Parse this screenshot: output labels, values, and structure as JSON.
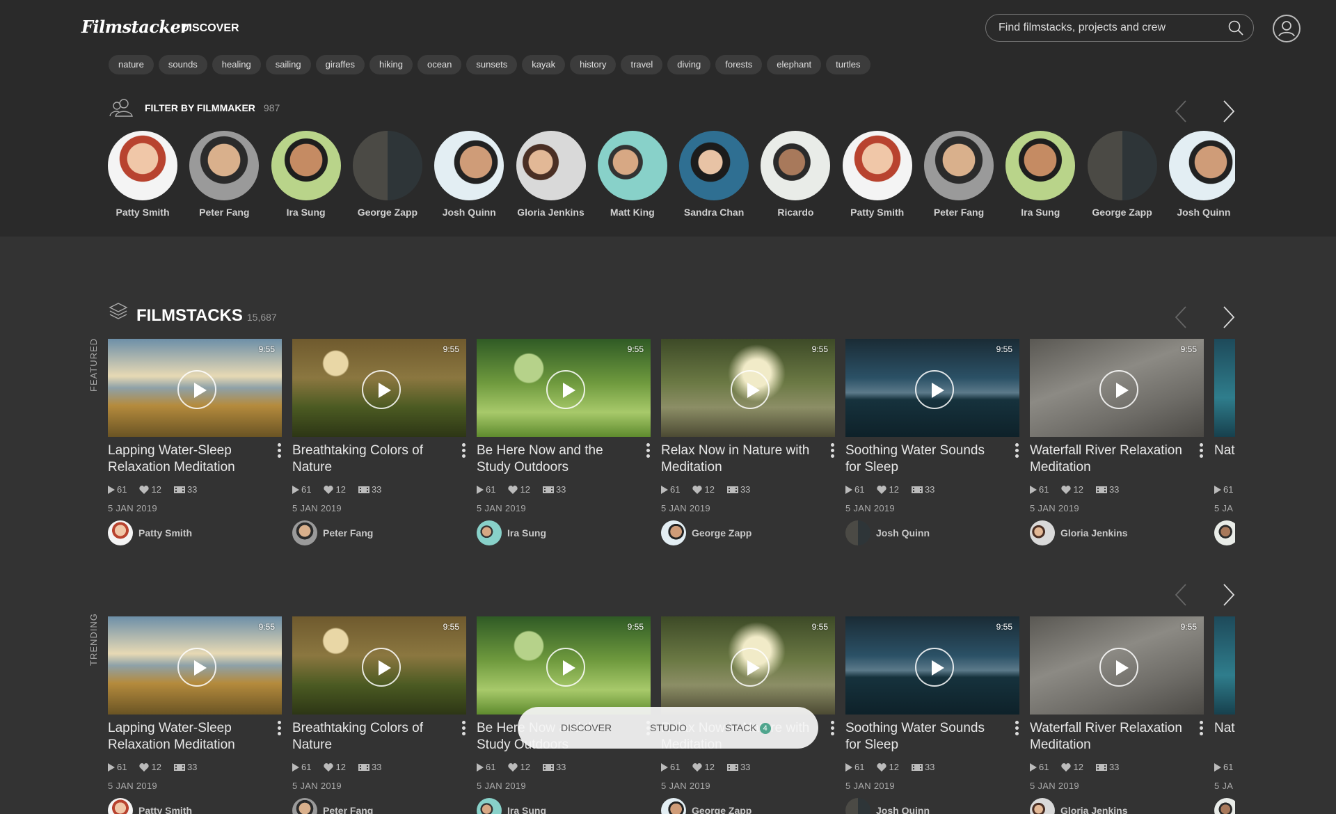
{
  "header": {
    "logo": "Filmstacker",
    "nav_discover": "DISCOVER",
    "search_placeholder": "Find filmstacks, projects and crew",
    "icons": [
      "search-icon",
      "user-icon"
    ]
  },
  "tags": [
    "nature",
    "sounds",
    "healing",
    "sailing",
    "giraffes",
    "hiking",
    "ocean",
    "sunsets",
    "kayak",
    "history",
    "travel",
    "diving",
    "forests",
    "elephant",
    "turtles"
  ],
  "filter": {
    "title": "FILTER BY FILMMAKER",
    "count": "987",
    "makers": [
      "Patty Smith",
      "Peter Fang",
      "Ira Sung",
      "George Zapp",
      "Josh Quinn",
      "Gloria Jenkins",
      "Matt King",
      "Sandra Chan",
      "Ricardo",
      "Patty Smith",
      "Peter Fang",
      "Ira Sung",
      "George Zapp",
      "Josh Quinn"
    ]
  },
  "filmstacks": {
    "title": "FILMSTACKS",
    "count": "15,687",
    "rows": [
      {
        "label": "FEATURED",
        "cards": [
          {
            "title": "Lapping Water-Sleep Relaxation Meditation",
            "duration": "9:55",
            "views": "61",
            "likes": "12",
            "clips": "33",
            "date": "5 JAN 2019",
            "owner": "Patty Smith"
          },
          {
            "title": "Breathtaking Colors of Nature",
            "duration": "9:55",
            "views": "61",
            "likes": "12",
            "clips": "33",
            "date": "5 JAN 2019",
            "owner": "Peter Fang"
          },
          {
            "title": "Be Here Now and the Study Outdoors",
            "duration": "9:55",
            "views": "61",
            "likes": "12",
            "clips": "33",
            "date": "5 JAN 2019",
            "owner": "Ira Sung"
          },
          {
            "title": "Relax Now in Nature with Meditation",
            "duration": "9:55",
            "views": "61",
            "likes": "12",
            "clips": "33",
            "date": "5 JAN 2019",
            "owner": "George Zapp"
          },
          {
            "title": "Soothing Water Sounds for Sleep",
            "duration": "9:55",
            "views": "61",
            "likes": "12",
            "clips": "33",
            "date": "5 JAN 2019",
            "owner": "Josh Quinn"
          },
          {
            "title": "Waterfall River Relaxation Meditation",
            "duration": "9:55",
            "views": "61",
            "likes": "12",
            "clips": "33",
            "date": "5 JAN 2019",
            "owner": "Gloria Jenkins"
          },
          {
            "title": "Nat Sin",
            "duration": "",
            "views": "61",
            "likes": "",
            "clips": "",
            "date": "5 JA",
            "owner": ""
          }
        ]
      },
      {
        "label": "TRENDING",
        "cards": [
          {
            "title": "Lapping Water-Sleep Relaxation Meditation",
            "duration": "9:55",
            "views": "61",
            "likes": "12",
            "clips": "33",
            "date": "5 JAN 2019",
            "owner": "Patty Smith"
          },
          {
            "title": "Breathtaking Colors of Nature",
            "duration": "9:55",
            "views": "61",
            "likes": "12",
            "clips": "33",
            "date": "5 JAN 2019",
            "owner": "Peter Fang"
          },
          {
            "title": "Be Here Now and the Study Outdoors",
            "duration": "9:55",
            "views": "61",
            "likes": "12",
            "clips": "33",
            "date": "5 JAN 2019",
            "owner": "Ira Sung"
          },
          {
            "title": "Relax Now in Nature with Meditation",
            "duration": "9:55",
            "views": "61",
            "likes": "12",
            "clips": "33",
            "date": "5 JAN 2019",
            "owner": "George Zapp"
          },
          {
            "title": "Soothing Water Sounds for Sleep",
            "duration": "9:55",
            "views": "61",
            "likes": "12",
            "clips": "33",
            "date": "5 JAN 2019",
            "owner": "Josh Quinn"
          },
          {
            "title": "Waterfall River Relaxation Meditation",
            "duration": "9:55",
            "views": "61",
            "likes": "12",
            "clips": "33",
            "date": "5 JAN 2019",
            "owner": "Gloria Jenkins"
          },
          {
            "title": "Nat Sin",
            "duration": "",
            "views": "61",
            "likes": "",
            "clips": "",
            "date": "5 JA",
            "owner": ""
          }
        ]
      }
    ]
  },
  "bottom_nav": {
    "discover": "DISCOVER",
    "studio": "STUDIO",
    "stack": "STACK",
    "stack_badge": "4"
  }
}
